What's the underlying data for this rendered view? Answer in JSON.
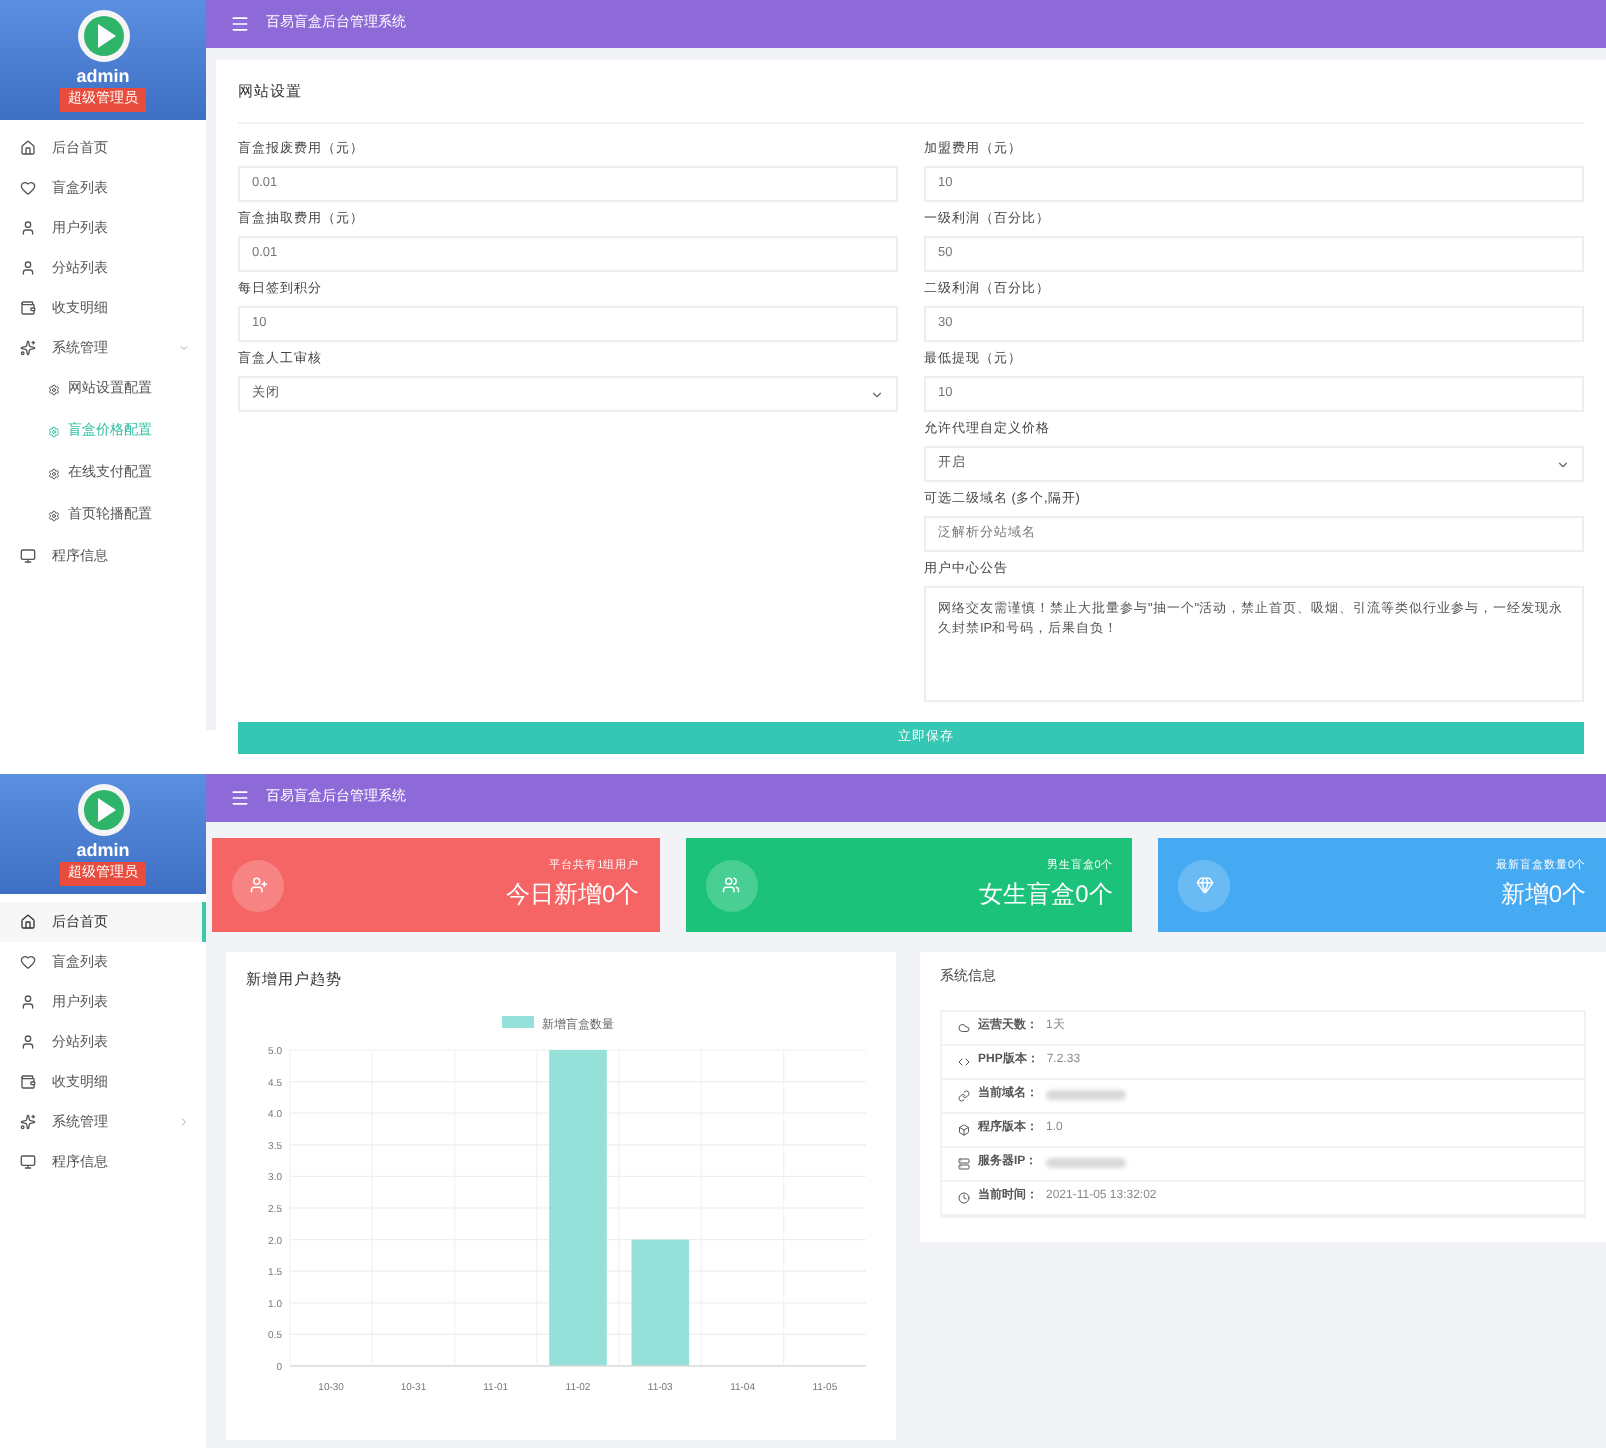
{
  "settings_screen": {
    "header": {
      "title": "百易盲盒后台管理系统"
    },
    "sidebar": {
      "user": "admin",
      "role": "超级管理员",
      "items": [
        {
          "label": "后台首页",
          "selected": false
        },
        {
          "label": "盲盒列表",
          "selected": false
        },
        {
          "label": "用户列表",
          "selected": false
        },
        {
          "label": "分站列表",
          "selected": false
        },
        {
          "label": "收支明细",
          "selected": false
        },
        {
          "label": "系统管理",
          "selected": false,
          "expanded": true,
          "children": [
            {
              "label": "网站设置配置",
              "selected": false
            },
            {
              "label": "盲盒价格配置",
              "selected": true
            },
            {
              "label": "在线支付配置",
              "selected": false
            },
            {
              "label": "首页轮播配置",
              "selected": false
            }
          ]
        },
        {
          "label": "程序信息",
          "selected": false
        }
      ]
    },
    "card_title": "网站设置",
    "left_fields": [
      {
        "kind": "input",
        "label": "盲盒报废费用（元）",
        "value": "0.01"
      },
      {
        "kind": "input",
        "label": "盲盒抽取费用（元）",
        "value": "0.01"
      },
      {
        "kind": "input",
        "label": "每日签到积分",
        "value": "10"
      },
      {
        "kind": "select",
        "label": "盲盒人工审核",
        "value": "关闭"
      }
    ],
    "right_fields": [
      {
        "kind": "input",
        "label": "加盟费用（元）",
        "value": "10"
      },
      {
        "kind": "input",
        "label": "一级利润（百分比）",
        "value": "50"
      },
      {
        "kind": "input",
        "label": "二级利润（百分比）",
        "value": "30"
      },
      {
        "kind": "input",
        "label": "最低提现（元）",
        "value": "10"
      },
      {
        "kind": "select",
        "label": "允许代理自定义价格",
        "value": "开启"
      },
      {
        "kind": "input",
        "label": "可选二级域名 (多个,隔开)",
        "value": "泛解析分站域名"
      },
      {
        "kind": "textarea",
        "label": "用户中心公告",
        "value": "网络交友需谨慎！禁止大批量参与\"抽一个\"活动，禁止首页、吸烟、引流等类似行业参与，一经发现永久封禁IP和号码，后果自负！"
      }
    ],
    "save_button": "立即保存"
  },
  "dashboard_screen": {
    "header": {
      "title": "百易盲盒后台管理系统"
    },
    "sidebar": {
      "user": "admin",
      "role": "超级管理员",
      "items": [
        {
          "label": "后台首页",
          "selected": true
        },
        {
          "label": "盲盒列表",
          "selected": false
        },
        {
          "label": "用户列表",
          "selected": false
        },
        {
          "label": "分站列表",
          "selected": false
        },
        {
          "label": "收支明细",
          "selected": false
        },
        {
          "label": "系统管理",
          "selected": false,
          "expanded": false
        },
        {
          "label": "程序信息",
          "selected": false
        }
      ]
    },
    "stat_cards": [
      {
        "caption": "平台共有1组用户",
        "value": "今日新增0个",
        "color": "#f56565"
      },
      {
        "caption": "男生盲盒0个",
        "value": "女生盲盒0个",
        "color": "#1cc27a"
      },
      {
        "caption": "最新盲盒数量0个",
        "value": "新增0个",
        "color": "#45aaf2"
      }
    ],
    "chart_card": {
      "title": "新增用户趋势",
      "chart_data": {
        "type": "bar",
        "categories": [
          "10-30",
          "10-31",
          "11-01",
          "11-02",
          "11-03",
          "11-04",
          "11-05"
        ],
        "series": [
          {
            "name": "新增盲盒数量",
            "color": "#95e1d9",
            "values": [
              0,
              0,
              0,
              5,
              2,
              0,
              0
            ]
          }
        ],
        "ylim": [
          0,
          5
        ],
        "grid": true,
        "yticks": [
          0,
          0.5,
          {
            "value": 1,
            "label": "1.0"
          },
          1.5,
          {
            "value": 2,
            "label": "2.0"
          },
          2.5,
          {
            "value": 3,
            "label": "3.0"
          },
          3.5,
          {
            "value": 4,
            "label": "4.0"
          },
          4.5,
          {
            "value": 5,
            "label": "5.0"
          }
        ]
      }
    },
    "system_info": {
      "title": "系统信息",
      "rows": [
        {
          "label": "运营天数：",
          "value": "1天"
        },
        {
          "label": "PHP版本：",
          "value": "7.2.33"
        },
        {
          "label": "当前域名：",
          "blurred": true
        },
        {
          "label": "程序版本：",
          "value": "1.0"
        },
        {
          "label": "服务器IP：",
          "blurred": true
        },
        {
          "label": "当前时间：",
          "value": "2021-11-05 13:32:02"
        }
      ]
    }
  }
}
